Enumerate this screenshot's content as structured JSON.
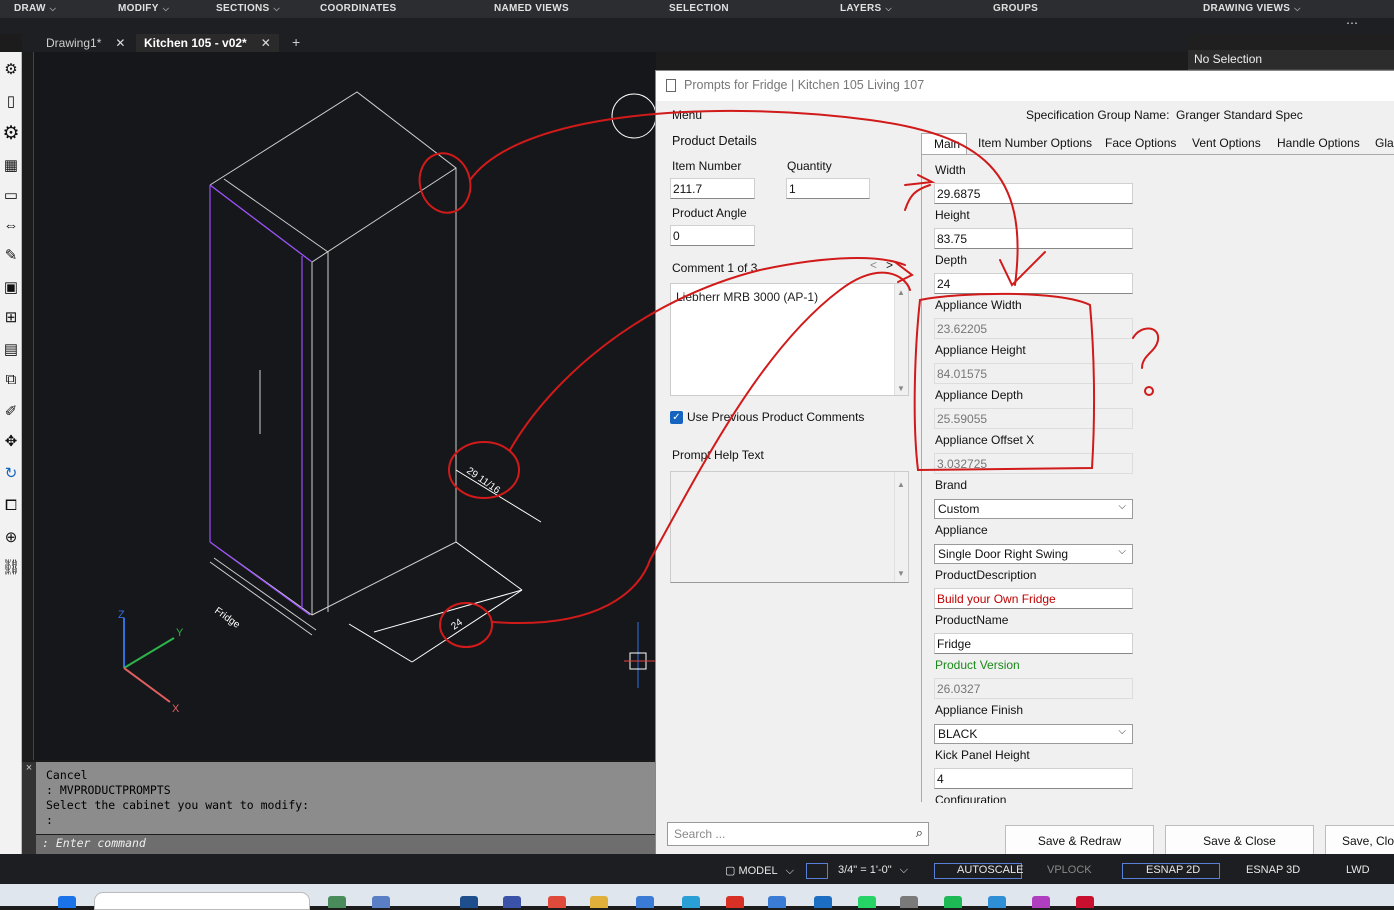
{
  "ribbon": {
    "items": [
      {
        "label": "DRAW",
        "chevron": true
      },
      {
        "label": "MODIFY",
        "chevron": true
      },
      {
        "label": "SECTIONS",
        "chevron": true
      },
      {
        "label": "COORDINATES",
        "chevron": false
      },
      {
        "label": "NAMED VIEWS",
        "chevron": false
      },
      {
        "label": "SELECTION",
        "chevron": false
      },
      {
        "label": "LAYERS",
        "chevron": true
      },
      {
        "label": "GROUPS",
        "chevron": false
      },
      {
        "label": "DRAWING VIEWS",
        "chevron": true
      }
    ],
    "more": "⋯"
  },
  "tabs": {
    "doc1": "Drawing1*",
    "doc2": "Kitchen 105 - v02*",
    "close": "✕",
    "add": "+"
  },
  "props_panel": {
    "selection": "No Selection"
  },
  "canvas": {
    "label_fridge": "Fridge",
    "dim_width": "29 11/16",
    "dim_depth": "24",
    "axis_x": "X",
    "axis_y": "Y",
    "axis_z": "Z",
    "annotation_question": "?"
  },
  "command": {
    "lines": [
      "Cancel",
      ": MVPRODUCTPROMPTS",
      "Select the cabinet you want to modify:",
      ":"
    ],
    "input_placeholder": ": Enter command",
    "handle": "×"
  },
  "dialog": {
    "title": "Prompts for Fridge | Kitchen 105 Living 107",
    "menu": "Menu",
    "spec_group_label": "Specification Group Name:",
    "spec_group_value": "Granger Standard Spec",
    "product_details": "Product Details",
    "item_number_label": "Item Number",
    "item_number_value": "211.7",
    "quantity_label": "Quantity",
    "quantity_value": "1",
    "product_angle_label": "Product Angle",
    "product_angle_value": "0",
    "comment_label": "Comment 1 of 3",
    "comment_prev": "<",
    "comment_next": ">",
    "comment_text": "Liebherr MRB 3000 (AP-1)",
    "use_prev_label": "Use Previous Product Comments",
    "use_prev_checked": "✓",
    "help_label": "Prompt Help Text",
    "tabs": [
      "Main",
      "Item Number Options",
      "Face Options",
      "Vent Options",
      "Handle Options",
      "Gla"
    ],
    "fields": {
      "width_label": "Width",
      "width": "29.6875",
      "height_label": "Height",
      "height": "83.75",
      "depth_label": "Depth",
      "depth": "24",
      "app_width_label": "Appliance Width",
      "app_width": "23.62205",
      "app_height_label": "Appliance Height",
      "app_height": "84.01575",
      "app_depth_label": "Appliance Depth",
      "app_depth": "25.59055",
      "app_offset_label": "Appliance Offset X",
      "app_offset": "3.032725",
      "brand_label": "Brand",
      "brand": "Custom",
      "appliance_label": "Appliance",
      "appliance": "Single Door Right Swing",
      "pdesc_label": "ProductDescription",
      "pdesc": "Build your Own Fridge",
      "pname_label": "ProductName",
      "pname": "Fridge",
      "pversion_label": "Product Version",
      "pversion": "26.0327",
      "finish_label": "Appliance Finish",
      "finish": "BLACK",
      "kick_label": "Kick Panel Height",
      "kick": "4",
      "config_label": "Configuration"
    },
    "search_placeholder": "Search ...",
    "buttons": {
      "save_redraw": "Save & Redraw",
      "save_close": "Save & Close",
      "save_close2": "Save, Clos"
    }
  },
  "status": {
    "model": "MODEL",
    "scale": "3/4\" = 1'-0\"",
    "autoscale": "AUTOSCALE",
    "vplock": "VPLOCK",
    "esnap2d": "ESNAP 2D",
    "esnap3d": "ESNAP 3D",
    "lwd": "LWD"
  },
  "colors": {
    "annotation": "#d11a1a",
    "accent": "#1565c0"
  }
}
